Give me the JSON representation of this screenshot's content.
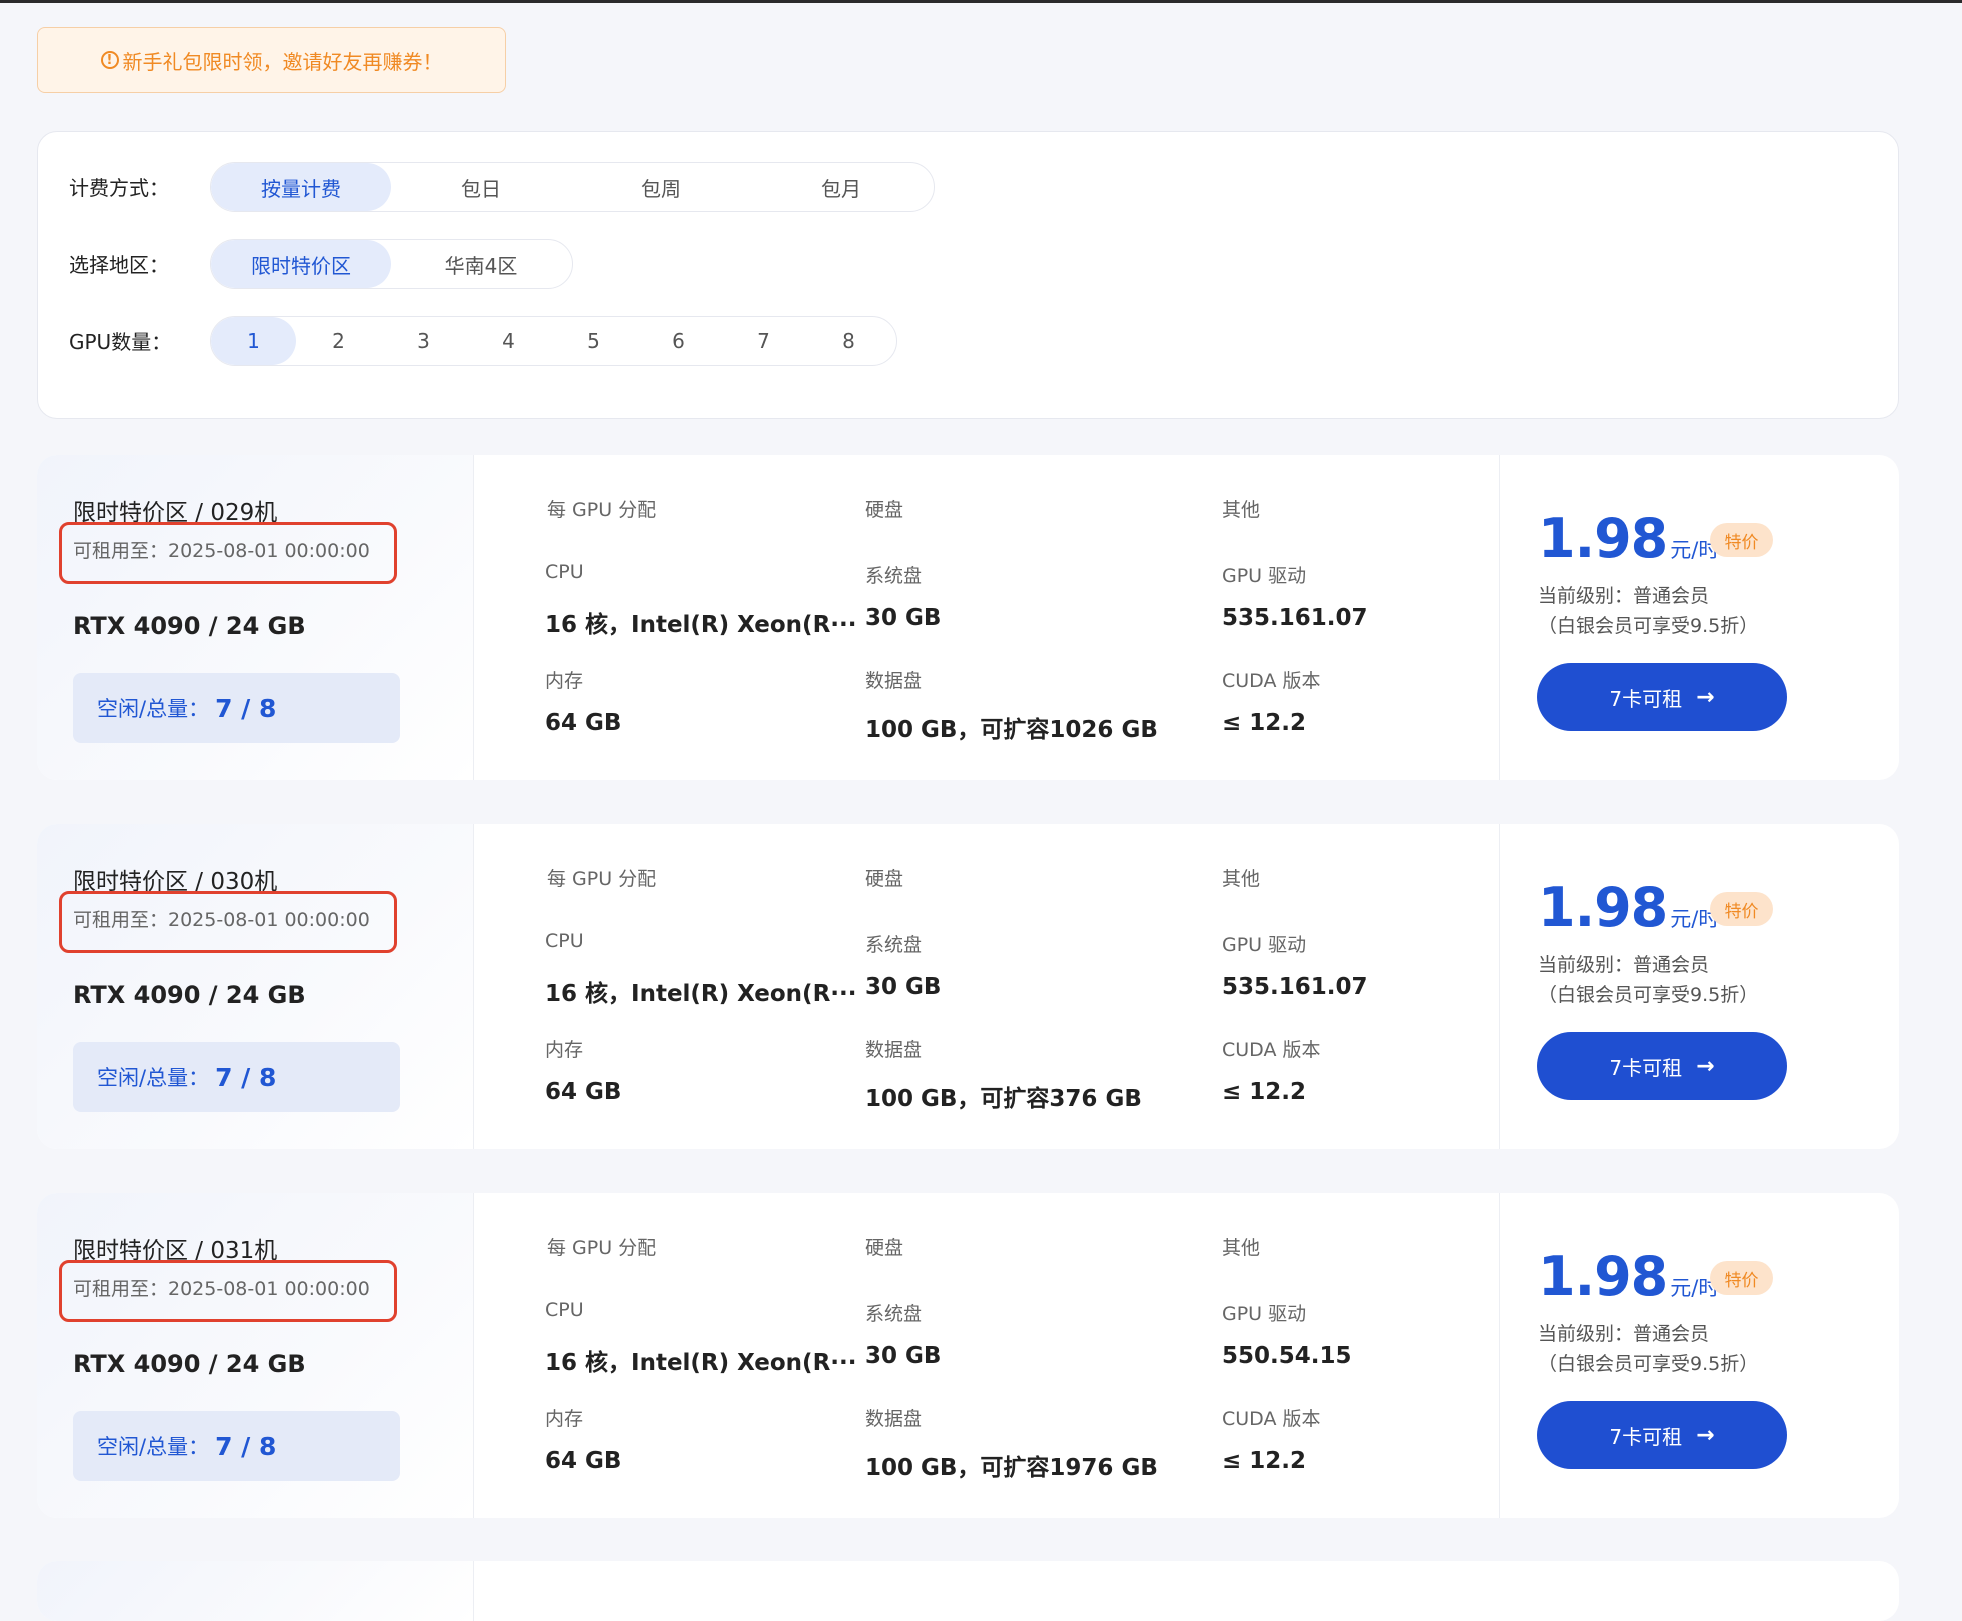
{
  "notice": {
    "icon": "info-icon",
    "text": "新手礼包限时领，邀请好友再赚券！"
  },
  "filters": {
    "billing": {
      "label": "计费方式：",
      "options": [
        "按量计费",
        "包日",
        "包周",
        "包月"
      ],
      "selected": "按量计费"
    },
    "region": {
      "label": "选择地区：",
      "options": [
        "限时特价区",
        "华南4区"
      ],
      "selected": "限时特价区"
    },
    "gpu_count": {
      "label": "GPU数量：",
      "options": [
        "1",
        "2",
        "3",
        "4",
        "5",
        "6",
        "7",
        "8"
      ],
      "selected": "1"
    }
  },
  "labels": {
    "per_gpu": "每 GPU 分配",
    "disk": "硬盘",
    "other": "其他",
    "cpu": "CPU",
    "memory": "内存",
    "system_disk": "系统盘",
    "data_disk": "数据盘",
    "gpu_driver": "GPU 驱动",
    "cuda_version": "CUDA 版本",
    "stock_label": "空闲/总量：",
    "price_unit": "元/时",
    "special_tag": "特价"
  },
  "machines": [
    {
      "title": "限时特价区 / 029机",
      "available_until": "可租用至：2025-08-01 00:00:00",
      "gpu": "RTX 4090 / 24 GB",
      "stock": "7 / 8",
      "cpu": "16 核，Intel(R) Xeon(R···",
      "memory": "64 GB",
      "system_disk": "30 GB",
      "data_disk": "100 GB，可扩容1026 GB",
      "gpu_driver": "535.161.07",
      "cuda": "≤ 12.2",
      "price": "1.98",
      "level": "当前级别：普通会员",
      "discount": "（白银会员可享受9.5折）",
      "rent_label": "7卡可租"
    },
    {
      "title": "限时特价区 / 030机",
      "available_until": "可租用至：2025-08-01 00:00:00",
      "gpu": "RTX 4090 / 24 GB",
      "stock": "7 / 8",
      "cpu": "16 核，Intel(R) Xeon(R···",
      "memory": "64 GB",
      "system_disk": "30 GB",
      "data_disk": "100 GB，可扩容376 GB",
      "gpu_driver": "535.161.07",
      "cuda": "≤ 12.2",
      "price": "1.98",
      "level": "当前级别：普通会员",
      "discount": "（白银会员可享受9.5折）",
      "rent_label": "7卡可租"
    },
    {
      "title": "限时特价区 / 031机",
      "available_until": "可租用至：2025-08-01 00:00:00",
      "gpu": "RTX 4090 / 24 GB",
      "stock": "7 / 8",
      "cpu": "16 核，Intel(R) Xeon(R···",
      "memory": "64 GB",
      "system_disk": "30 GB",
      "data_disk": "100 GB，可扩容1976 GB",
      "gpu_driver": "550.54.15",
      "cuda": "≤ 12.2",
      "price": "1.98",
      "level": "当前级别：普通会员",
      "discount": "（白银会员可享受9.5折）",
      "rent_label": "7卡可租"
    }
  ],
  "colors": {
    "accent": "#1f4fd1",
    "accent_light": "#e4ebfb",
    "notice_orange": "#f08a24",
    "highlight_red": "#e0412e",
    "background": "#f5f6fa"
  }
}
